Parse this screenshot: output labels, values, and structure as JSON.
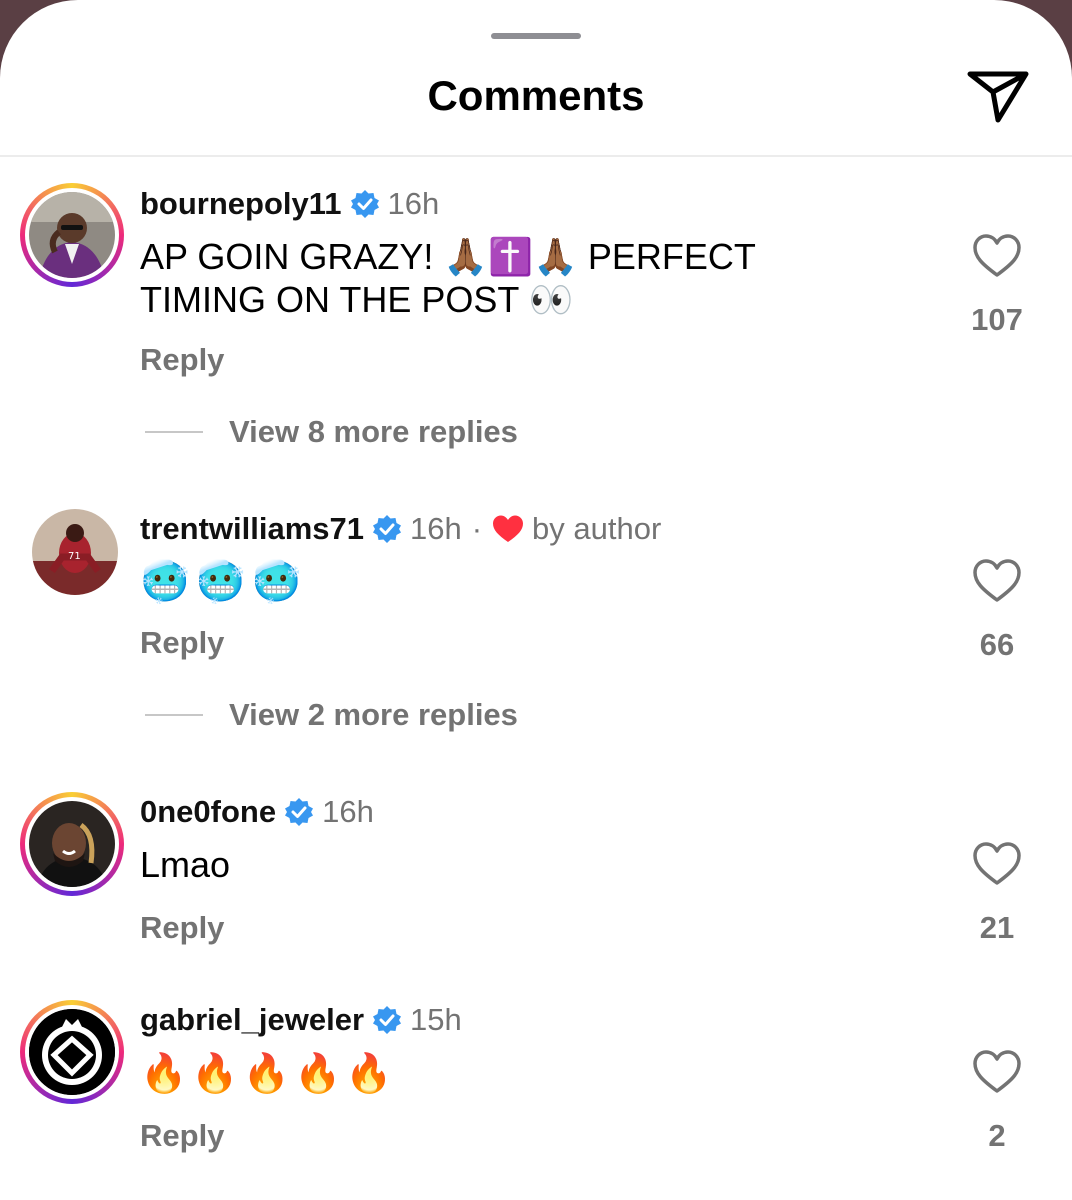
{
  "header": {
    "title": "Comments"
  },
  "comments": [
    {
      "username": "bournepoly11",
      "time": "16h",
      "text_line1": "AP GOIN GRAZY! 🙏🏾✝️🙏🏾 PERFECT",
      "text_line2": "TIMING ON THE POST 👀",
      "reply_label": "Reply",
      "likes": "107",
      "view_more": "View 8 more replies"
    },
    {
      "username": "trentwilliams71",
      "time": "16h",
      "separator": "·",
      "by_author": "by author",
      "text": "🥶🥶🥶",
      "reply_label": "Reply",
      "likes": "66",
      "view_more": "View 2 more replies"
    },
    {
      "username": "0ne0fone",
      "time": "16h",
      "text": "Lmao",
      "reply_label": "Reply",
      "likes": "21"
    },
    {
      "username": "gabriel_jeweler",
      "time": "15h",
      "text": "🔥🔥🔥🔥🔥",
      "reply_label": "Reply",
      "likes": "2"
    }
  ],
  "colors": {
    "verified": "#3897f0",
    "muted": "#737373",
    "liked": "#ff3040"
  }
}
